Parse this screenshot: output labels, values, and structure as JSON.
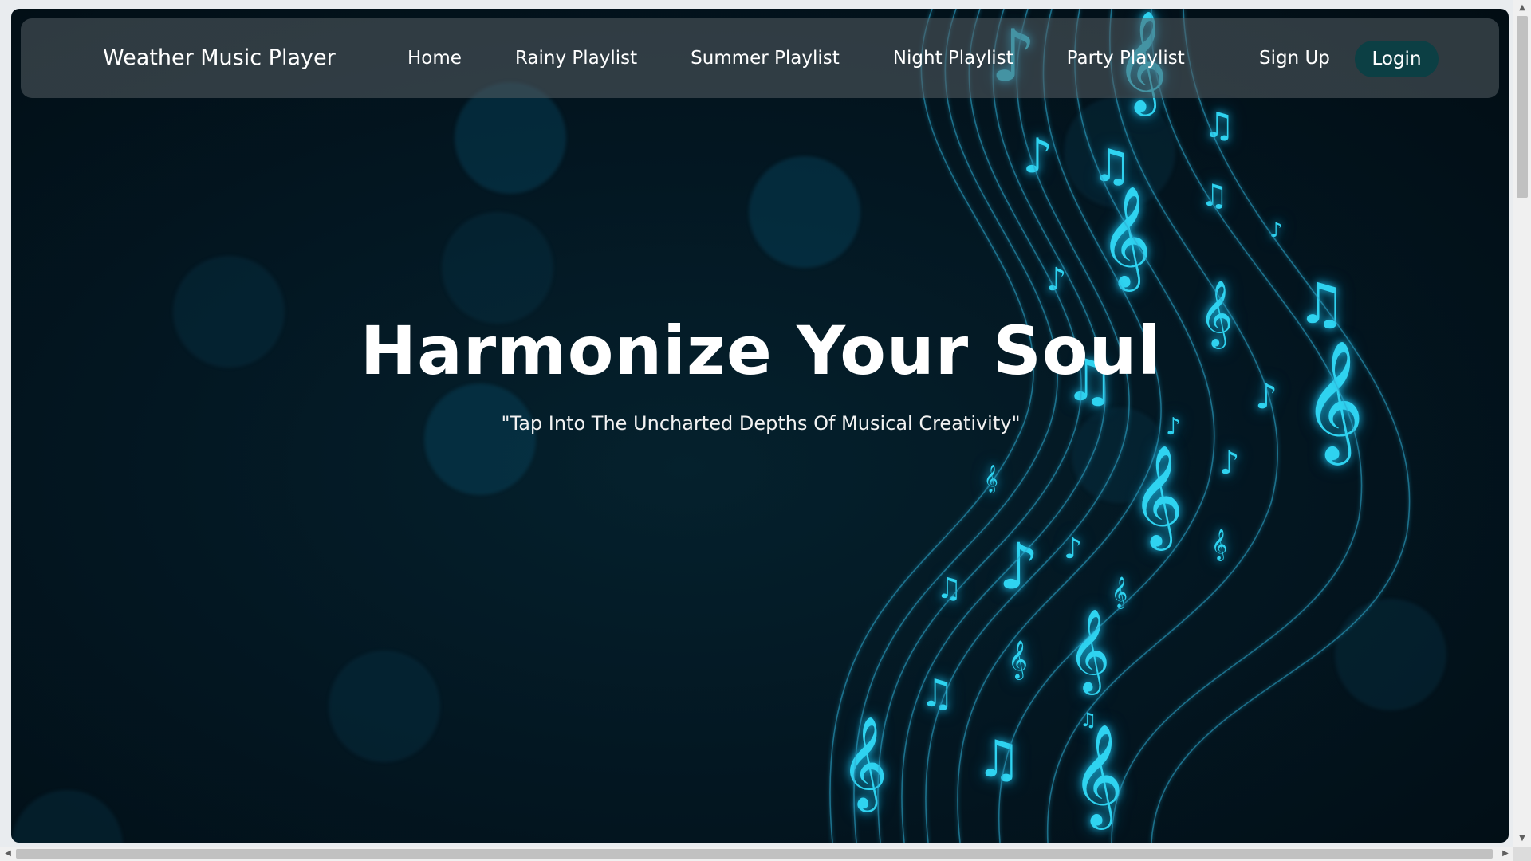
{
  "navbar": {
    "brand": "Weather Music Player",
    "links": [
      {
        "label": "Home"
      },
      {
        "label": "Rainy Playlist"
      },
      {
        "label": "Summer Playlist"
      },
      {
        "label": "Night Playlist"
      },
      {
        "label": "Party Playlist"
      }
    ],
    "signup_label": "Sign Up",
    "login_label": "Login"
  },
  "hero": {
    "title": "Harmonize Your Soul",
    "subtitle": "\"Tap Into The Uncharted Depths Of Musical Creativity\""
  },
  "colors": {
    "background": "#031722",
    "accent": "#2fd3f0",
    "login_button": "#0c3f44"
  },
  "icons": {
    "treble_clef": "𝄞",
    "eighth_note": "♪",
    "beamed_notes": "♫"
  }
}
